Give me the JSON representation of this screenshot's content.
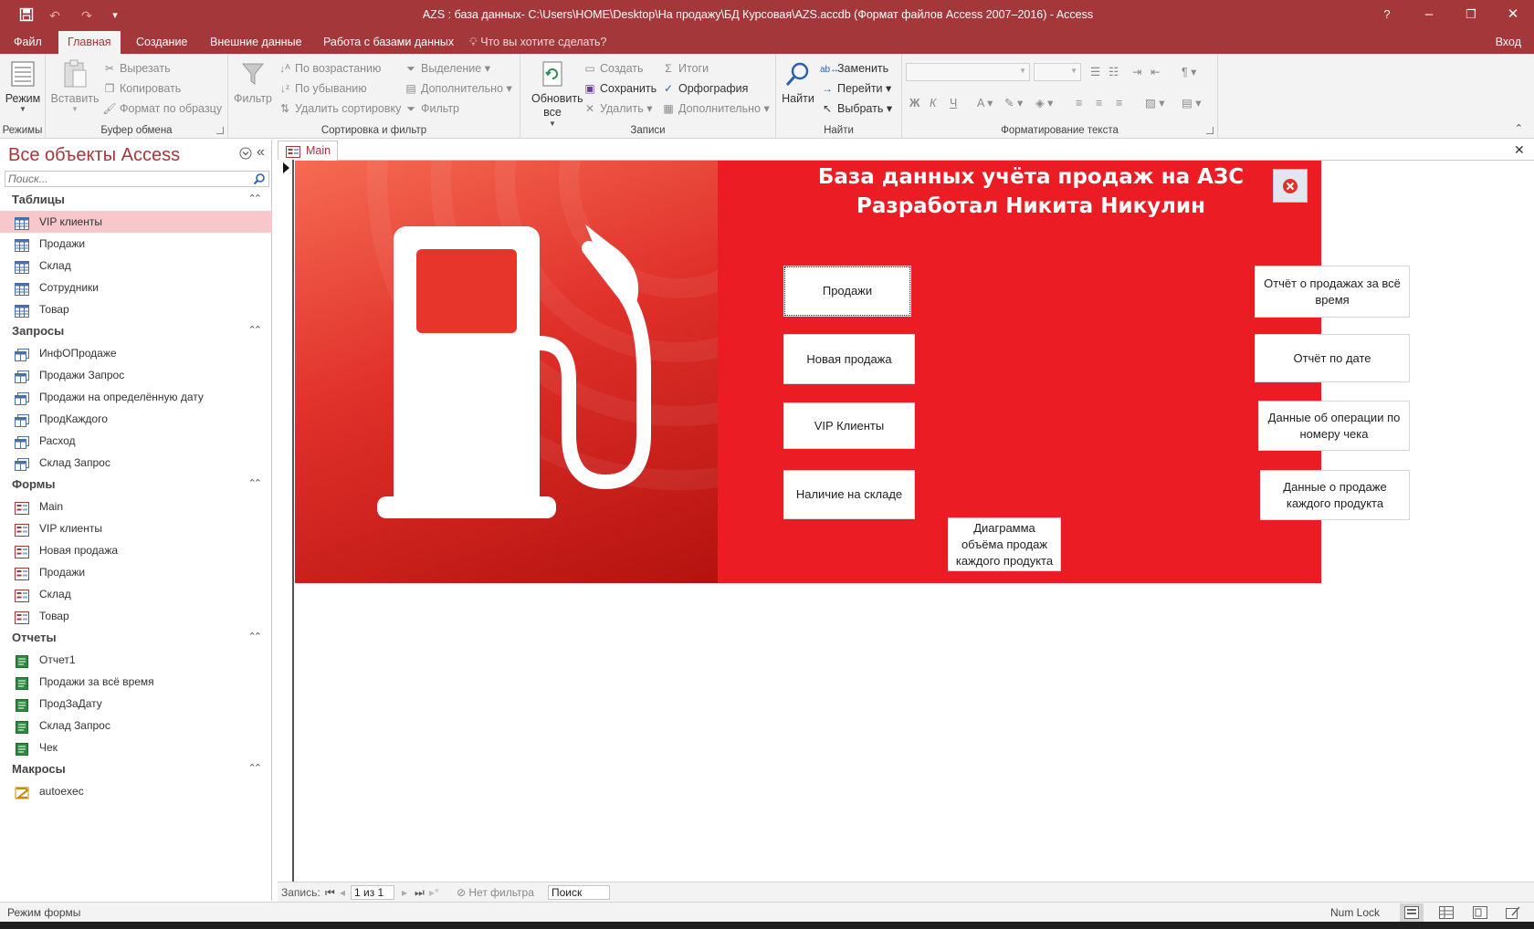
{
  "window": {
    "title": "AZS : база данных- C:\\Users\\HOME\\Desktop\\На продажу\\БД Курсовая\\AZS.accdb (Формат файлов Access 2007–2016) - Access",
    "help": "?",
    "minimize": "–",
    "restore": "❐",
    "close": "✕"
  },
  "quick_access": {
    "undo": "↶",
    "redo": "↷",
    "customize": "▾"
  },
  "ribbon_tabs": [
    "Файл",
    "Главная",
    "Создание",
    "Внешние данные",
    "Работа с базами данных"
  ],
  "tell_me": "Что вы хотите сделать?",
  "sign_in": "Вход",
  "ribbon": {
    "views": {
      "mode": "Режим",
      "group": "Режимы"
    },
    "clipboard": {
      "paste": "Вставить",
      "cut": "Вырезать",
      "copy": "Копировать",
      "format_painter": "Формат по образцу",
      "group": "Буфер обмена"
    },
    "sort_filter": {
      "filter": "Фильтр",
      "ascending": "По возрастанию",
      "descending": "По убыванию",
      "remove_sort": "Удалить сортировку",
      "selection": "Выделение",
      "advanced": "Дополнительно",
      "toggle_filter": "Фильтр",
      "group": "Сортировка и фильтр"
    },
    "records": {
      "refresh": "Обновить все",
      "new": "Создать",
      "save": "Сохранить",
      "delete": "Удалить",
      "totals": "Итоги",
      "spelling": "Орфография",
      "more": "Дополнительно",
      "group": "Записи"
    },
    "find": {
      "find": "Найти",
      "replace": "Заменить",
      "goto": "Перейти",
      "select": "Выбрать",
      "group": "Найти"
    },
    "text_format": {
      "bold": "Ж",
      "italic": "К",
      "underline": "Ч",
      "group": "Форматирование текста"
    }
  },
  "nav": {
    "title": "Все объекты Access",
    "search_placeholder": "Поиск...",
    "groups": [
      {
        "name": "Таблицы",
        "type": "table",
        "items": [
          "VIP клиенты",
          "Продажи",
          "Склад",
          "Сотрудники",
          "Товар"
        ]
      },
      {
        "name": "Запросы",
        "type": "query",
        "items": [
          "ИнфОПродаже",
          "Продажи Запрос",
          "Продажи на определённую дату",
          "ПродКаждого",
          "Расход",
          "Склад Запрос"
        ]
      },
      {
        "name": "Формы",
        "type": "form",
        "items": [
          "Main",
          "VIP клиенты",
          "Новая продажа",
          "Продажи",
          "Склад",
          "Товар"
        ]
      },
      {
        "name": "Отчеты",
        "type": "report",
        "items": [
          "Отчет1",
          "Продажи за всё время",
          "ПродЗаДату",
          "Склад Запрос",
          "Чек"
        ]
      },
      {
        "name": "Макросы",
        "type": "macro",
        "items": [
          "autoexec"
        ]
      }
    ],
    "selected": "VIP клиенты"
  },
  "document_tab": "Main",
  "form": {
    "title_line1": "База данных учёта продаж на АЗС",
    "title_line2": "Разработал Никита Никулин",
    "buttons": {
      "sales": "Продажи",
      "new_sale": "Новая продажа",
      "vip": "VIP Клиенты",
      "stock": "Наличие на складе",
      "report_all": "Отчёт о продажах за всё время",
      "report_date": "Отчёт по дате",
      "op_by_check": "Данные об операции по номеру чека",
      "sale_per_product": "Данные о продаже каждого продукта",
      "chart": "Диаграмма объёма продаж каждого продукта"
    }
  },
  "record_nav": {
    "label": "Запись:",
    "position": "1 из 1",
    "no_filter": "Нет фильтра",
    "search": "Поиск"
  },
  "status": {
    "mode": "Режим формы",
    "num_lock": "Num Lock"
  },
  "colors": {
    "accent": "#a4373a",
    "form_red": "#ec1c24",
    "selection": "#f8c7cb"
  }
}
